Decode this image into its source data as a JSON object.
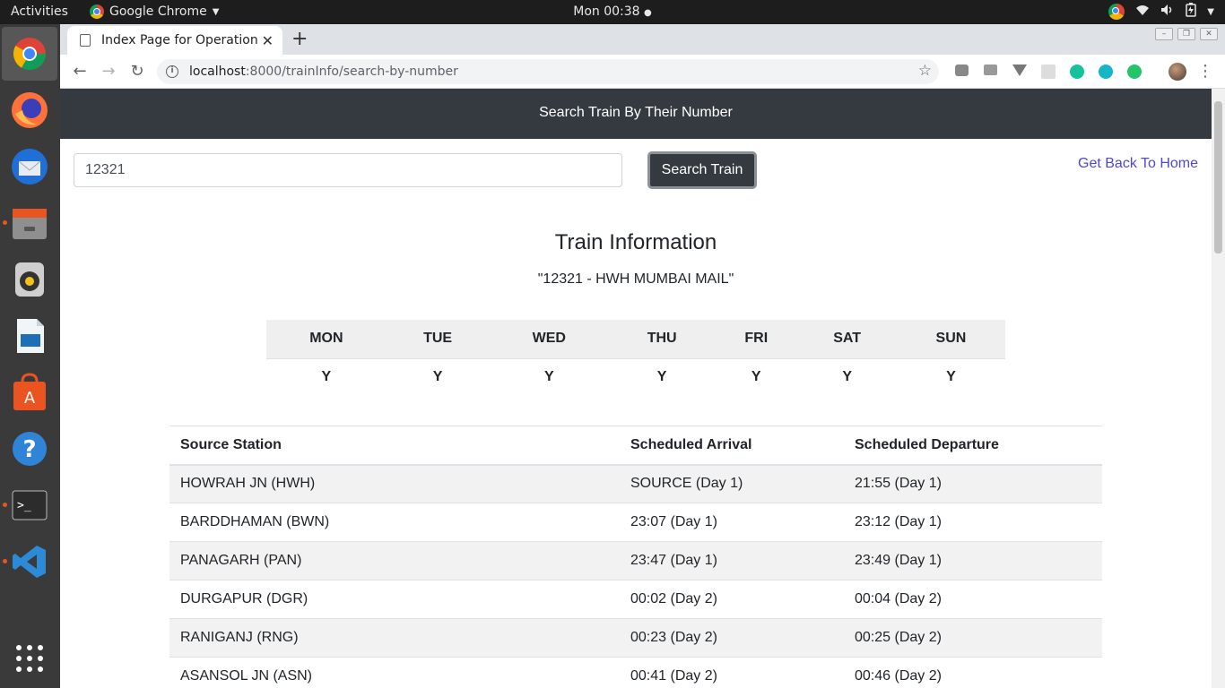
{
  "topbar": {
    "activities": "Activities",
    "app_name": "Google Chrome",
    "clock": "Mon 00:38"
  },
  "dock": {
    "apps": [
      "chrome-icon",
      "firefox-icon",
      "thunderbird-icon",
      "files-icon",
      "rhythmbox-icon",
      "writer-icon",
      "software-icon",
      "help-icon",
      "terminal-icon",
      "vscode-icon",
      "app-grid-icon"
    ]
  },
  "browser": {
    "tab_title": "Index Page for Operation",
    "url_host": "localhost",
    "url_path": ":8000/trainInfo/search-by-number"
  },
  "page": {
    "header": "Search Train By Their Number",
    "search_value": "12321",
    "search_button": "Search Train",
    "home_link": "Get Back To Home",
    "info_title": "Train Information",
    "train_name": "\"12321 - HWH MUMBAI MAIL\""
  },
  "days": {
    "headers": [
      "MON",
      "TUE",
      "WED",
      "THU",
      "FRI",
      "SAT",
      "SUN"
    ],
    "values": [
      "Y",
      "Y",
      "Y",
      "Y",
      "Y",
      "Y",
      "Y"
    ]
  },
  "stations": {
    "headers": [
      "Source Station",
      "Scheduled Arrival",
      "Scheduled Departure"
    ],
    "rows": [
      [
        "HOWRAH JN (HWH)",
        "SOURCE (Day 1)",
        "21:55 (Day 1)"
      ],
      [
        "BARDDHAMAN (BWN)",
        "23:07 (Day 1)",
        "23:12 (Day 1)"
      ],
      [
        "PANAGARH (PAN)",
        "23:47 (Day 1)",
        "23:49 (Day 1)"
      ],
      [
        "DURGAPUR (DGR)",
        "00:02 (Day 2)",
        "00:04 (Day 2)"
      ],
      [
        "RANIGANJ (RNG)",
        "00:23 (Day 2)",
        "00:25 (Day 2)"
      ],
      [
        "ASANSOL JN (ASN)",
        "00:41 (Day 2)",
        "00:46 (Day 2)"
      ]
    ]
  },
  "colors": {
    "header_bg": "#343a40",
    "link": "#5046d8",
    "accent": "#e95420"
  }
}
